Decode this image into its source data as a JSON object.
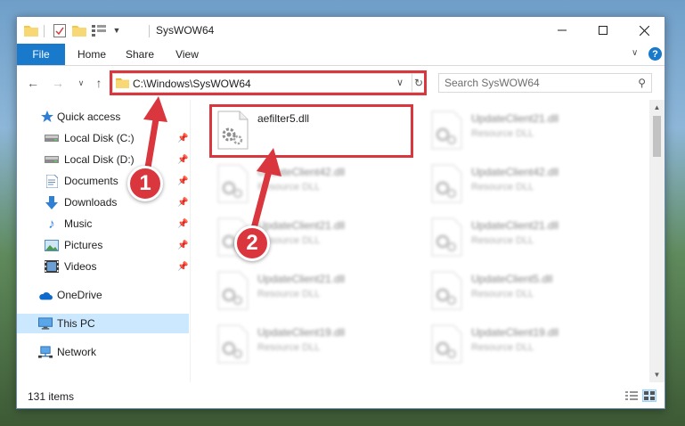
{
  "window": {
    "title": "SysWOW64"
  },
  "ribbon": {
    "tabs": [
      "File",
      "Home",
      "Share",
      "View"
    ],
    "help_label": "?"
  },
  "navigation": {
    "address": "C:\\Windows\\SysWOW64",
    "search_placeholder": "Search SysWOW64"
  },
  "sidebar": {
    "items": [
      {
        "label": "Quick access",
        "icon": "star-icon"
      },
      {
        "label": "Local Disk (C:)",
        "icon": "drive-icon",
        "pinned": true
      },
      {
        "label": "Local Disk (D:)",
        "icon": "drive-icon",
        "pinned": true
      },
      {
        "label": "Documents",
        "icon": "documents-icon",
        "pinned": true
      },
      {
        "label": "Downloads",
        "icon": "download-icon",
        "pinned": true
      },
      {
        "label": "Music",
        "icon": "music-icon",
        "pinned": true
      },
      {
        "label": "Pictures",
        "icon": "pictures-icon",
        "pinned": true
      },
      {
        "label": "Videos",
        "icon": "videos-icon",
        "pinned": true
      },
      {
        "label": "OneDrive",
        "icon": "cloud-icon"
      },
      {
        "label": "This PC",
        "icon": "computer-icon",
        "selected": true
      },
      {
        "label": "Network",
        "icon": "network-icon"
      }
    ]
  },
  "files": [
    {
      "name": "aefilter5.dll",
      "type": "",
      "highlighted": true
    },
    {
      "name": "UpdateClient21.dll",
      "type": "Resource DLL"
    },
    {
      "name": "UpdateClient42.dll",
      "type": "Resource DLL"
    },
    {
      "name": "UpdateClient42.dll",
      "type": "Resource DLL"
    },
    {
      "name": "UpdateClient21.dll",
      "type": "Resource DLL"
    },
    {
      "name": "UpdateClient21.dll",
      "type": "Resource DLL"
    },
    {
      "name": "UpdateClient21.dll",
      "type": "Resource DLL"
    },
    {
      "name": "UpdateClient5.dll",
      "type": "Resource DLL"
    },
    {
      "name": "UpdateClient19.dll",
      "type": "Resource DLL"
    },
    {
      "name": "UpdateClient19.dll",
      "type": "Resource DLL"
    }
  ],
  "status": {
    "item_count": "131 items"
  },
  "annotations": {
    "step1": "1",
    "step2": "2"
  },
  "colors": {
    "accent": "#1979ca",
    "highlight": "#d9363e",
    "selected": "#cce8ff"
  }
}
